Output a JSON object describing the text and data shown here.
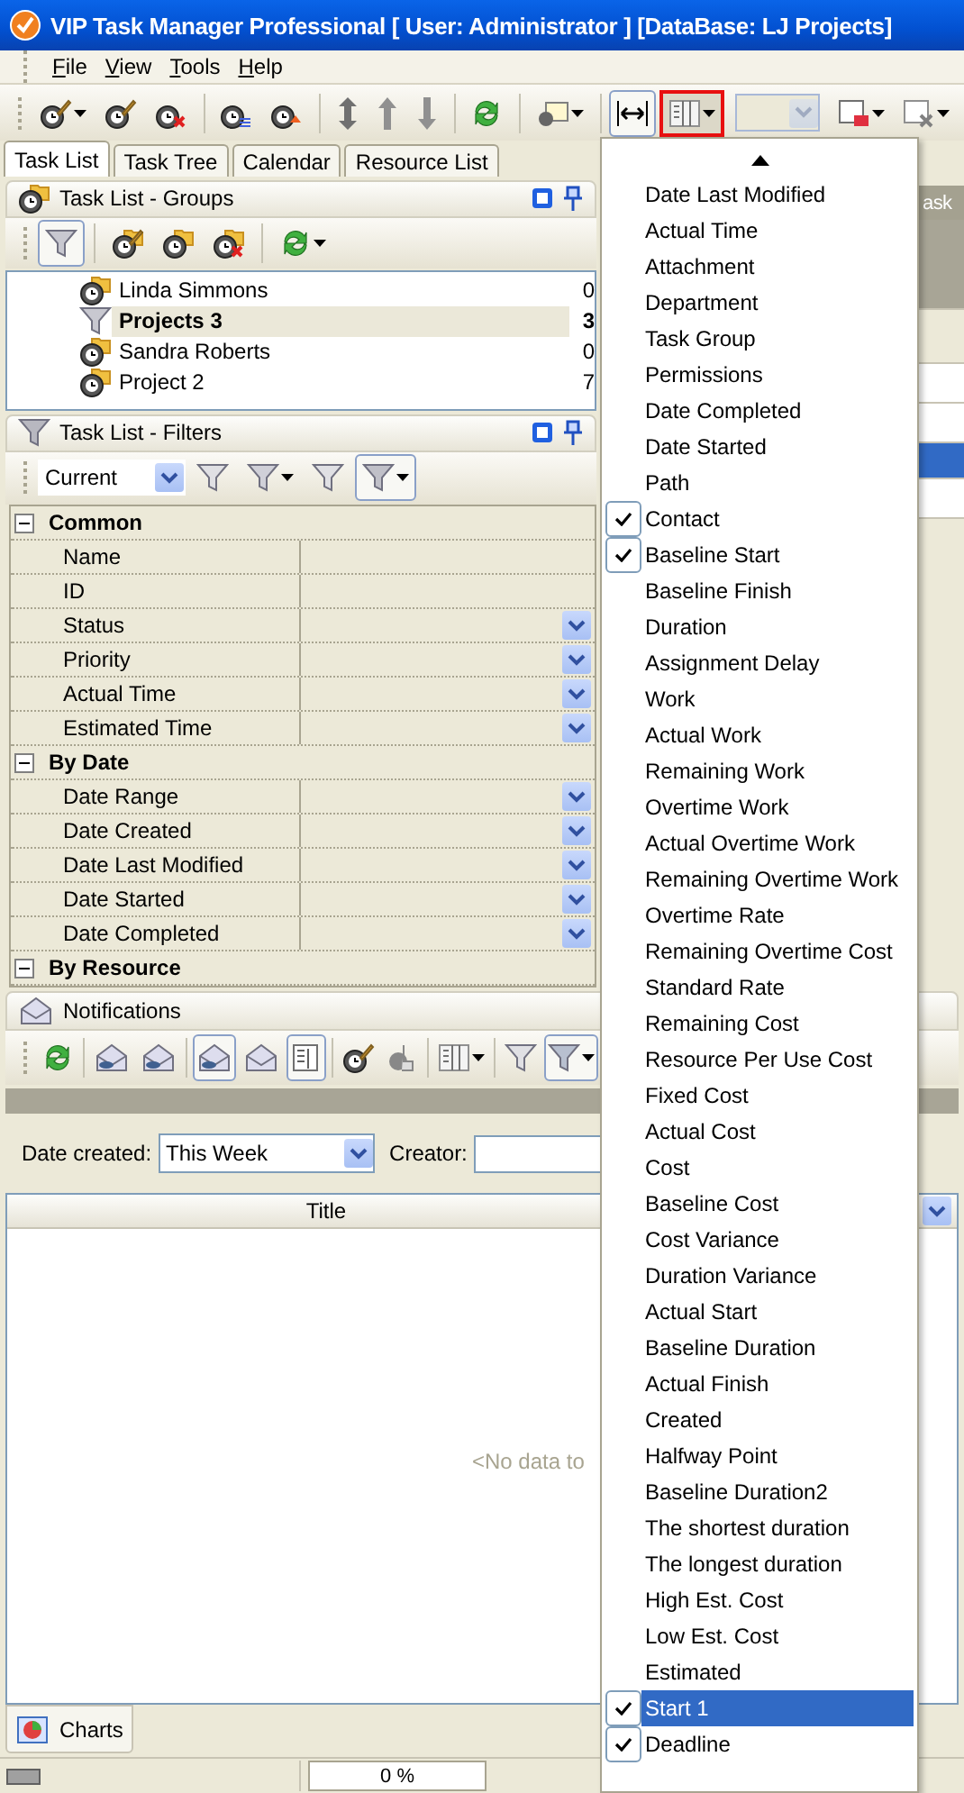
{
  "window": {
    "title": "VIP Task Manager Professional [ User: Administrator ] [DataBase: LJ Projects]"
  },
  "menu_bar": [
    {
      "label": "File"
    },
    {
      "label": "View"
    },
    {
      "label": "Tools"
    },
    {
      "label": "Help"
    }
  ],
  "toolbar": [
    {
      "kind": "button",
      "pressed": false,
      "highlighted": false,
      "dropdown": true
    },
    {
      "kind": "button",
      "pressed": false,
      "highlighted": false,
      "dropdown": false
    },
    {
      "kind": "button",
      "pressed": false,
      "highlighted": false,
      "dropdown": false
    },
    {
      "kind": "separator"
    },
    {
      "kind": "button",
      "pressed": false,
      "highlighted": false,
      "dropdown": false
    },
    {
      "kind": "button",
      "pressed": false,
      "highlighted": false,
      "dropdown": false
    },
    {
      "kind": "separator"
    },
    {
      "kind": "button",
      "pressed": false,
      "highlighted": false,
      "dropdown": false
    },
    {
      "kind": "button",
      "pressed": false,
      "highlighted": false,
      "dropdown": false
    },
    {
      "kind": "button",
      "pressed": false,
      "highlighted": false,
      "dropdown": false
    },
    {
      "kind": "separator"
    },
    {
      "kind": "button",
      "pressed": false,
      "highlighted": false,
      "dropdown": false
    },
    {
      "kind": "separator"
    },
    {
      "kind": "button",
      "pressed": false,
      "highlighted": false,
      "dropdown": true
    },
    {
      "kind": "separator"
    },
    {
      "kind": "button",
      "pressed": true,
      "highlighted": false,
      "dropdown": false
    },
    {
      "kind": "button",
      "pressed": false,
      "highlighted": true,
      "dropdown": true
    },
    {
      "kind": "combo",
      "disabled": true
    },
    {
      "kind": "button",
      "pressed": false,
      "highlighted": false,
      "dropdown": true
    },
    {
      "kind": "button",
      "pressed": false,
      "highlighted": false,
      "dropdown": true
    }
  ],
  "tabs": [
    {
      "label": "Task List",
      "selected": true
    },
    {
      "label": "Task Tree",
      "selected": false
    },
    {
      "label": "Calendar",
      "selected": false
    },
    {
      "label": "Resource List",
      "selected": false
    }
  ],
  "groups_panel": {
    "title": "Task List - Groups",
    "toolbar": [
      {
        "kind": "button",
        "pressed": true,
        "dropdown": false
      },
      {
        "kind": "separator"
      },
      {
        "kind": "button",
        "pressed": false,
        "dropdown": false
      },
      {
        "kind": "button",
        "pressed": false,
        "dropdown": false
      },
      {
        "kind": "button",
        "pressed": false,
        "dropdown": false
      },
      {
        "kind": "separator"
      },
      {
        "kind": "button",
        "pressed": false,
        "dropdown": true
      }
    ],
    "items": [
      {
        "kind": "group",
        "label": "Linda Simmons",
        "count": "0",
        "selected": false
      },
      {
        "kind": "filter",
        "label": "Projects 3",
        "count": "3",
        "selected": true
      },
      {
        "kind": "group",
        "label": "Sandra Roberts",
        "count": "0",
        "selected": false
      },
      {
        "kind": "group",
        "label": "Project 2",
        "count": "7",
        "selected": false
      }
    ]
  },
  "filters_panel": {
    "title": "Task List - Filters",
    "preset": "Current",
    "toolbar": [
      {
        "kind": "button",
        "pressed": false,
        "dropdown": false
      },
      {
        "kind": "button",
        "pressed": false,
        "dropdown": true
      },
      {
        "kind": "button",
        "pressed": false,
        "dropdown": false
      },
      {
        "kind": "button",
        "pressed": true,
        "dropdown": true
      }
    ],
    "sections": [
      {
        "title": "Common",
        "expanded": true,
        "rows": [
          {
            "label": "Name",
            "dropdown": false
          },
          {
            "label": "ID",
            "dropdown": false
          },
          {
            "label": "Status",
            "dropdown": true
          },
          {
            "label": "Priority",
            "dropdown": true
          },
          {
            "label": "Actual Time",
            "dropdown": true
          },
          {
            "label": "Estimated Time",
            "dropdown": true
          }
        ]
      },
      {
        "title": "By Date",
        "expanded": true,
        "rows": [
          {
            "label": "Date Range",
            "dropdown": true
          },
          {
            "label": "Date Created",
            "dropdown": true
          },
          {
            "label": "Date Last Modified",
            "dropdown": true
          },
          {
            "label": "Date Started",
            "dropdown": true
          },
          {
            "label": "Date Completed",
            "dropdown": true
          }
        ]
      },
      {
        "title": "By Resource",
        "expanded": true
      }
    ]
  },
  "right_panel": {
    "title": "ask"
  },
  "notifications": {
    "title": "Notifications",
    "toolbar": [
      {
        "kind": "button",
        "pressed": false,
        "dropdown": false
      },
      {
        "kind": "separator"
      },
      {
        "kind": "button",
        "pressed": false,
        "dropdown": false
      },
      {
        "kind": "button",
        "pressed": false,
        "dropdown": false
      },
      {
        "kind": "separator"
      },
      {
        "kind": "button",
        "pressed": true,
        "dropdown": false
      },
      {
        "kind": "button",
        "pressed": false,
        "dropdown": false
      },
      {
        "kind": "button",
        "pressed": true,
        "dropdown": false
      },
      {
        "kind": "separator"
      },
      {
        "kind": "button",
        "pressed": false,
        "dropdown": false
      },
      {
        "kind": "button",
        "pressed": false,
        "dropdown": false
      },
      {
        "kind": "separator"
      },
      {
        "kind": "button",
        "pressed": false,
        "dropdown": true
      },
      {
        "kind": "separator"
      },
      {
        "kind": "button",
        "pressed": false,
        "dropdown": false
      },
      {
        "kind": "button",
        "pressed": true,
        "dropdown": true
      }
    ],
    "date_created_label": "Date created:",
    "date_created": "This Week",
    "creator_label": "Creator:",
    "columns": [
      "Title"
    ],
    "empty_text": "<No data to"
  },
  "bottom_tabs": [
    {
      "label": "Charts",
      "selected": true
    }
  ],
  "status_bar": {
    "progress": "0 %",
    "level": 0
  },
  "column_menu": {
    "items": [
      {
        "label": "Date Last Modified",
        "checked": false,
        "selected": false
      },
      {
        "label": "Actual Time",
        "checked": false,
        "selected": false
      },
      {
        "label": "Attachment",
        "checked": false,
        "selected": false
      },
      {
        "label": "Department",
        "checked": false,
        "selected": false
      },
      {
        "label": "Task Group",
        "checked": false,
        "selected": false
      },
      {
        "label": "Permissions",
        "checked": false,
        "selected": false
      },
      {
        "label": "Date Completed",
        "checked": false,
        "selected": false
      },
      {
        "label": "Date Started",
        "checked": false,
        "selected": false
      },
      {
        "label": "Path",
        "checked": false,
        "selected": false
      },
      {
        "label": "Contact",
        "checked": true,
        "selected": false
      },
      {
        "label": "Baseline Start",
        "checked": true,
        "selected": false
      },
      {
        "label": "Baseline Finish",
        "checked": false,
        "selected": false
      },
      {
        "label": "Duration",
        "checked": false,
        "selected": false
      },
      {
        "label": "Assignment Delay",
        "checked": false,
        "selected": false
      },
      {
        "label": "Work",
        "checked": false,
        "selected": false
      },
      {
        "label": "Actual Work",
        "checked": false,
        "selected": false
      },
      {
        "label": "Remaining Work",
        "checked": false,
        "selected": false
      },
      {
        "label": "Overtime Work",
        "checked": false,
        "selected": false
      },
      {
        "label": "Actual Overtime Work",
        "checked": false,
        "selected": false
      },
      {
        "label": "Remaining Overtime Work",
        "checked": false,
        "selected": false
      },
      {
        "label": "Overtime Rate",
        "checked": false,
        "selected": false
      },
      {
        "label": "Remaining Overtime Cost",
        "checked": false,
        "selected": false
      },
      {
        "label": "Standard Rate",
        "checked": false,
        "selected": false
      },
      {
        "label": "Remaining Cost",
        "checked": false,
        "selected": false
      },
      {
        "label": "Resource Per Use Cost",
        "checked": false,
        "selected": false
      },
      {
        "label": "Fixed Cost",
        "checked": false,
        "selected": false
      },
      {
        "label": "Actual Cost",
        "checked": false,
        "selected": false
      },
      {
        "label": "Cost",
        "checked": false,
        "selected": false
      },
      {
        "label": "Baseline Cost",
        "checked": false,
        "selected": false
      },
      {
        "label": "Cost Variance",
        "checked": false,
        "selected": false
      },
      {
        "label": "Duration Variance",
        "checked": false,
        "selected": false
      },
      {
        "label": "Actual Start",
        "checked": false,
        "selected": false
      },
      {
        "label": "Baseline Duration",
        "checked": false,
        "selected": false
      },
      {
        "label": "Actual Finish",
        "checked": false,
        "selected": false
      },
      {
        "label": "Created",
        "checked": false,
        "selected": false
      },
      {
        "label": "Halfway Point",
        "checked": false,
        "selected": false
      },
      {
        "label": "Baseline Duration2",
        "checked": false,
        "selected": false
      },
      {
        "label": "The shortest duration",
        "checked": false,
        "selected": false
      },
      {
        "label": "The longest duration",
        "checked": false,
        "selected": false
      },
      {
        "label": "High Est. Cost",
        "checked": false,
        "selected": false
      },
      {
        "label": "Low Est. Cost",
        "checked": false,
        "selected": false
      },
      {
        "label": "Estimated",
        "checked": false,
        "selected": false
      },
      {
        "label": "Start 1",
        "checked": true,
        "selected": true
      },
      {
        "label": "Deadline",
        "checked": true,
        "selected": false
      }
    ]
  }
}
